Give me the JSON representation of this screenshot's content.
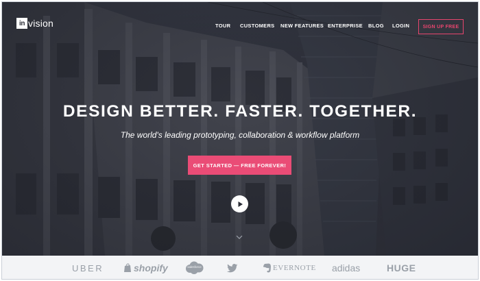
{
  "brand": {
    "logo_mark": "in",
    "logo_word": "vision"
  },
  "nav": {
    "items": [
      {
        "label": "TOUR"
      },
      {
        "label": "CUSTOMERS"
      },
      {
        "label": "NEW FEATURES"
      },
      {
        "label": "ENTERPRISE"
      },
      {
        "label": "BLOG"
      },
      {
        "label": "LOGIN"
      }
    ],
    "signup_label": "SIGN UP FREE"
  },
  "hero": {
    "headline": "DESIGN BETTER. FASTER. TOGETHER.",
    "subheadline": "The world's leading prototyping, collaboration & workflow platform",
    "cta_label": "GET STARTED — FREE FOREVER!",
    "play_icon": "play-icon",
    "scroll_icon": "chevron-down-icon"
  },
  "customers": {
    "logos": [
      {
        "name": "UBER"
      },
      {
        "name": "shopify"
      },
      {
        "name": "salesforce"
      },
      {
        "name": "twitter",
        "icon": "twitter-bird-icon"
      },
      {
        "name": "EVERNOTE"
      },
      {
        "name": "adidas"
      },
      {
        "name": "HUGE"
      }
    ]
  },
  "colors": {
    "accent": "#ea4c76",
    "signup_border": "#e8456e",
    "hero_overlay": "#2f323c",
    "strip_background": "#f3f4f6",
    "logo_gray": "#9aa0a8"
  }
}
